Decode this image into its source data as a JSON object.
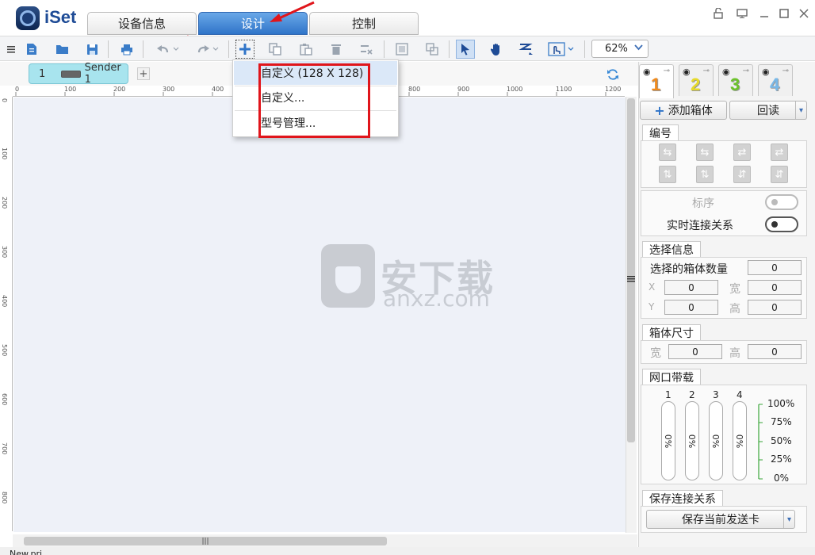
{
  "app": {
    "name": "iSet"
  },
  "tabs": [
    "设备信息",
    "设计",
    "控制"
  ],
  "active_tab": "设计",
  "toolbar": {
    "zoom": "62%"
  },
  "canvas": {
    "sender_tab": {
      "number": "1",
      "label": "Sender 1"
    },
    "ruler_h": [
      "0",
      "100",
      "200",
      "300",
      "400",
      "500",
      "600",
      "700",
      "800",
      "900",
      "1000",
      "1100",
      "1200"
    ],
    "ruler_v": [
      "0",
      "100",
      "200",
      "300",
      "400",
      "500",
      "600",
      "700",
      "800"
    ],
    "watermark": {
      "cn": "安下载",
      "en": "anxz.com"
    }
  },
  "dropdown": {
    "items": [
      "自定义 (128 X 128)",
      "自定义...",
      "型号管理..."
    ]
  },
  "panel": {
    "tabs": [
      {
        "number": "1",
        "color": "#f08a1c"
      },
      {
        "number": "2",
        "color": "#e6da2a"
      },
      {
        "number": "3",
        "color": "#6cc22a"
      },
      {
        "number": "4",
        "color": "#78b8e8"
      }
    ],
    "add_box_button": "添加箱体",
    "readback_button": "回读",
    "numbering": {
      "section": "编号",
      "order_label": "标序",
      "live_conn_label": "实时连接关系"
    },
    "selection": {
      "section": "选择信息",
      "count_label": "选择的箱体数量",
      "count": "0",
      "x_label": "X",
      "x": "0",
      "width_label": "宽",
      "width": "0",
      "y_label": "Y",
      "y": "0",
      "height_label": "高",
      "height": "0"
    },
    "box_size": {
      "section": "箱体尺寸",
      "width_label": "宽",
      "width": "0",
      "height_label": "高",
      "height": "0"
    },
    "bandwidth": {
      "section": "网口带载",
      "ports": [
        "1",
        "2",
        "3",
        "4"
      ],
      "values": [
        "0%",
        "0%",
        "0%",
        "0%"
      ],
      "scale": [
        "100%",
        "75%",
        "50%",
        "25%",
        "0%"
      ]
    },
    "save_conn": {
      "section": "保存连接关系",
      "button": "保存当前发送卡"
    }
  },
  "status": {
    "text": "New.prj"
  }
}
